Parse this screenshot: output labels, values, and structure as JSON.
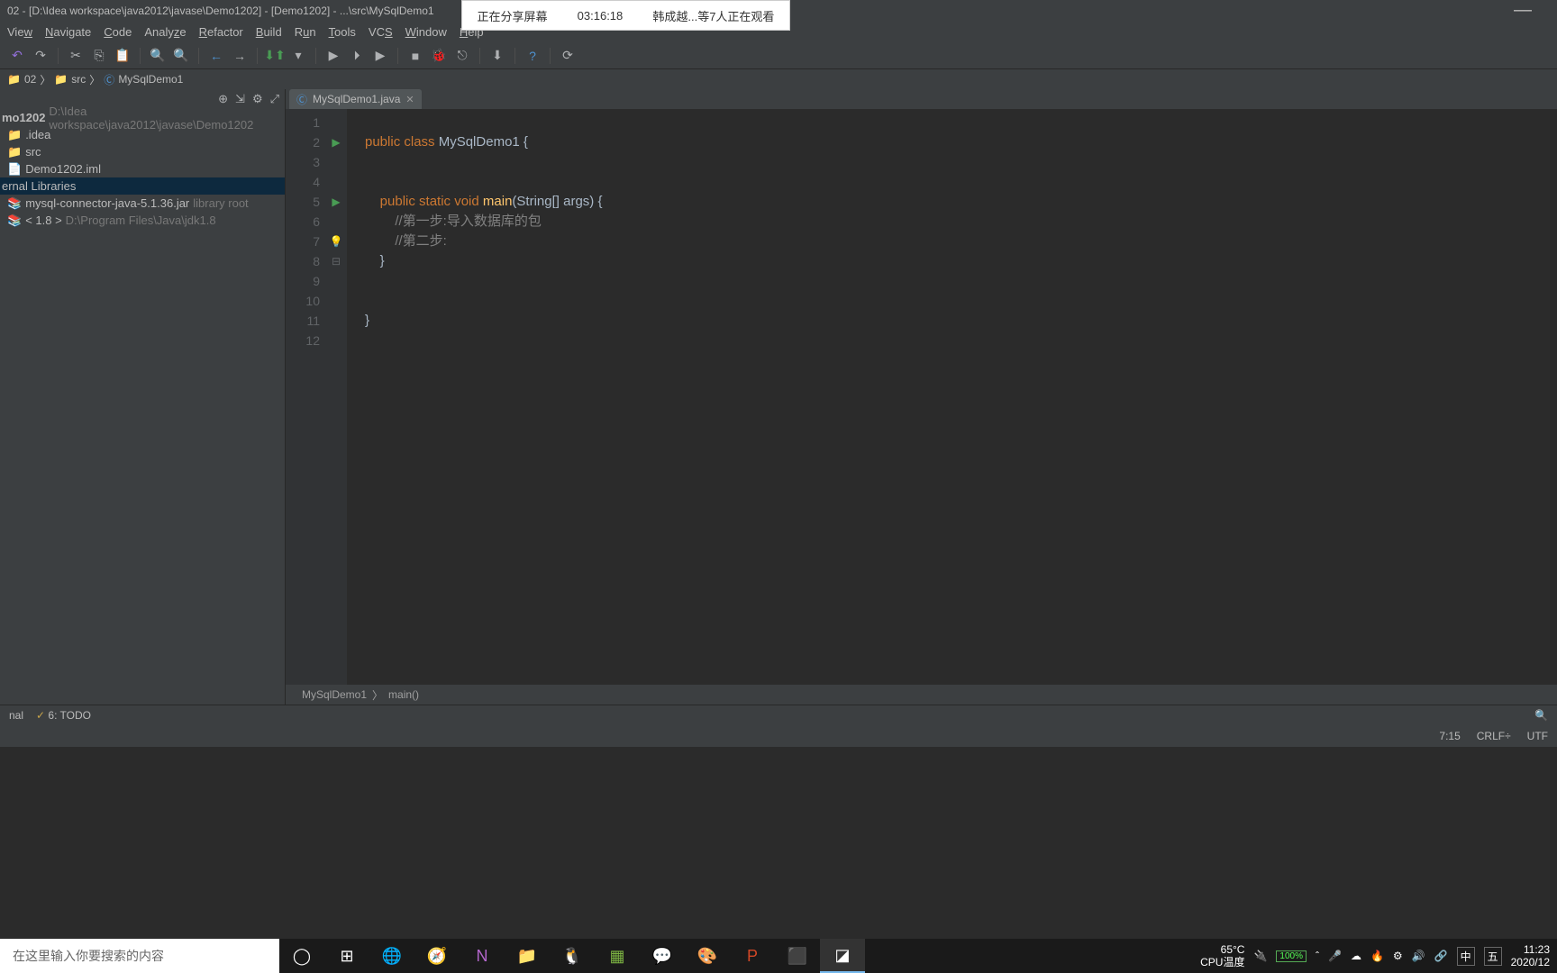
{
  "titlebar": {
    "text": "02 - [D:\\Idea workspace\\java2012\\javase\\Demo1202] - [Demo1202] - ...\\src\\MySqlDemo1",
    "minimize": "—"
  },
  "share_overlay": {
    "status": "正在分享屏幕",
    "time": "03:16:18",
    "viewers": "韩成越...等7人正在观看"
  },
  "menubar": {
    "items": [
      "View",
      "Navigate",
      "Code",
      "Analyze",
      "Refactor",
      "Build",
      "Run",
      "Tools",
      "VCS",
      "Window",
      "Help"
    ],
    "underline_chars": [
      "w",
      "N",
      "C",
      "",
      "R",
      "B",
      "u",
      "T",
      "S",
      "W",
      "H"
    ]
  },
  "breadcrumb": {
    "items": [
      "02",
      "src",
      "MySqlDemo1"
    ]
  },
  "sidebar": {
    "project": "mo1202",
    "project_path": "D:\\Idea workspace\\java2012\\javase\\Demo1202",
    "tree": [
      {
        "label": ".idea",
        "indent": 1
      },
      {
        "label": "src",
        "indent": 1
      },
      {
        "label": "Demo1202.iml",
        "indent": 1
      },
      {
        "label": "ernal Libraries",
        "indent": 0,
        "selected": true
      },
      {
        "label": "mysql-connector-java-5.1.36.jar",
        "suffix": "library root",
        "indent": 1
      },
      {
        "label": "< 1.8 >",
        "suffix": "D:\\Program Files\\Java\\jdk1.8",
        "indent": 1
      }
    ]
  },
  "editor": {
    "tab": {
      "label": "MySqlDemo1.java"
    },
    "lines": [
      {
        "n": 1,
        "html": ""
      },
      {
        "n": 2,
        "icon": "play",
        "html": "<span class='kw'>public class</span> <span class='id'>MySqlDemo1 {</span>"
      },
      {
        "n": 3,
        "html": ""
      },
      {
        "n": 4,
        "html": ""
      },
      {
        "n": 5,
        "icon": "play",
        "fold": "⊟",
        "html": "    <span class='kw'>public static void</span> <span class='fn'>main</span><span class='id'>(String[] args) {</span>"
      },
      {
        "n": 6,
        "fold": "",
        "html": "        <span class='cm'>//第一步:导入数据库的包</span>"
      },
      {
        "n": 7,
        "bulb": true,
        "fold": "",
        "html": "        <span class='cm'>//第二步:</span>"
      },
      {
        "n": 8,
        "fold": "⊟",
        "html": "    <span class='id'>}</span>"
      },
      {
        "n": 9,
        "html": ""
      },
      {
        "n": 10,
        "html": ""
      },
      {
        "n": 11,
        "html": "<span class='id'>}</span>"
      },
      {
        "n": 12,
        "html": ""
      }
    ],
    "crumb": [
      "MySqlDemo1",
      "main()"
    ]
  },
  "bottombar": {
    "left": [
      "nal",
      "6: TODO"
    ],
    "right_icon": "🔍"
  },
  "statusbar": {
    "pos": "7:15",
    "eol": "CRLF÷",
    "enc": "UTF"
  },
  "taskbar": {
    "search_placeholder": "在这里输入你要搜索的内容",
    "cpu_temp": "65°C",
    "cpu_label": "CPU温度",
    "battery": "100%",
    "ime1": "中",
    "ime2": "五",
    "time": "11:23",
    "date": "2020/12"
  }
}
